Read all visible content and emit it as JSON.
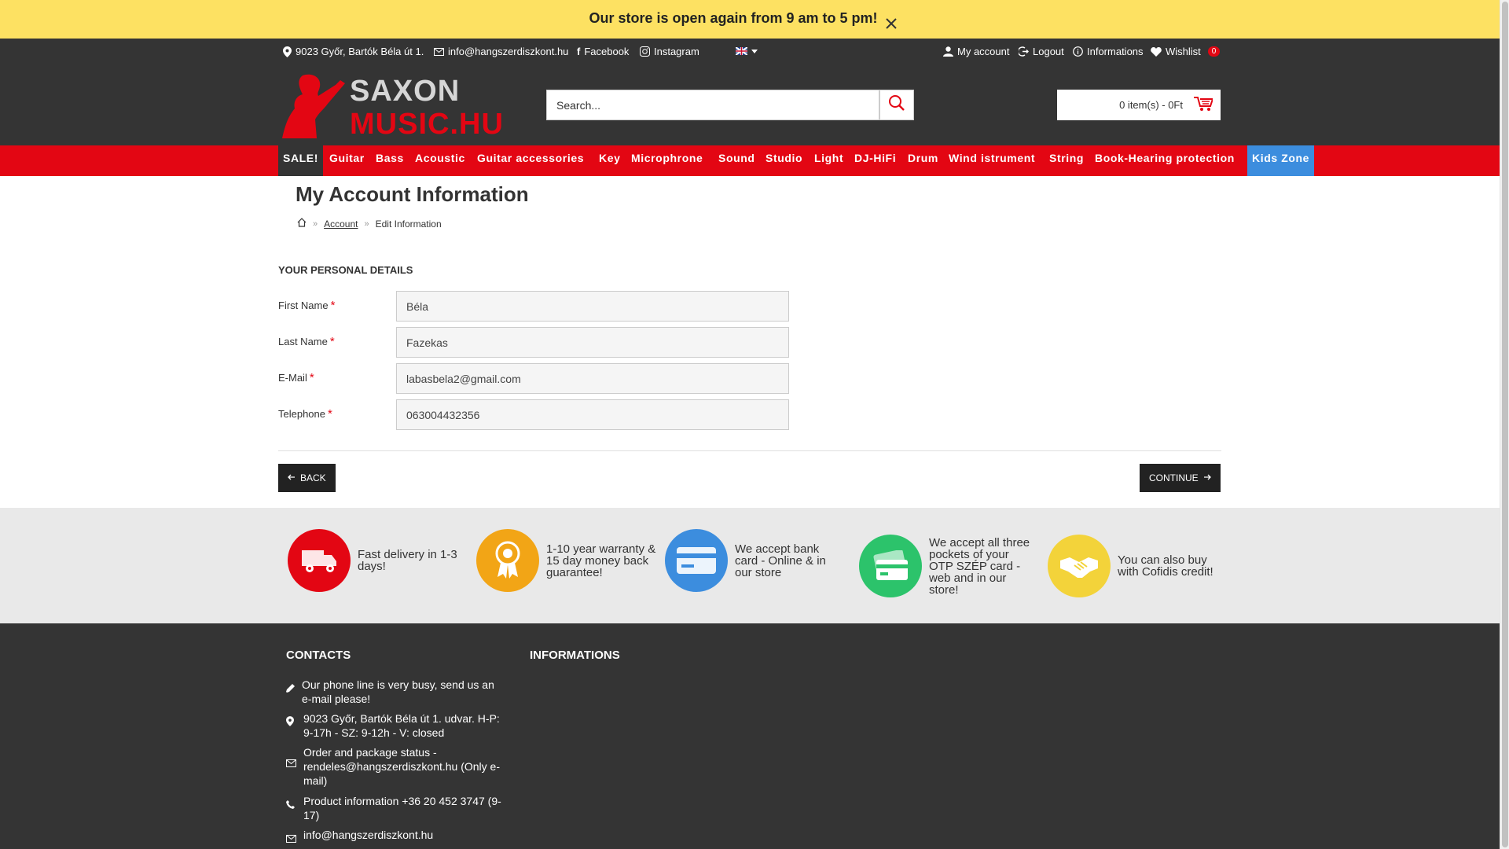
{
  "notice": {
    "text": "Our store is open again from 9 am to 5 pm!",
    "close_icon": "close-icon"
  },
  "topbar": {
    "address": "9023 Győr, Bartók Béla út 1.",
    "email": "info@hangszerdiszkont.hu",
    "facebook": "Facebook",
    "instagram": "Instagram",
    "language_icon": "uk-flag-icon",
    "my_account": "My account",
    "logout": "Logout",
    "informations": "Informations",
    "wishlist": "Wishlist",
    "wishlist_count": "0"
  },
  "header": {
    "logo_line1": "SAXON",
    "logo_line2": "MUSIC.HU",
    "search_placeholder": "Search...",
    "cart_text": "0 item(s) - 0Ft"
  },
  "menu": {
    "items": [
      "SALE!",
      "Guitar",
      "Bass",
      "Acoustic",
      "Guitar accessories",
      "Key",
      "Microphrone",
      "Sound",
      "Studio",
      "Light",
      "DJ-HiFi",
      "Drum",
      "Wind istrument",
      "String",
      "Book-Hearing protection",
      "Kids Zone"
    ]
  },
  "page": {
    "title": "My Account Information",
    "breadcrumb": [
      "Account",
      "Edit Information"
    ]
  },
  "form": {
    "legend": "YOUR PERSONAL DETAILS",
    "fields": [
      {
        "label": "First Name",
        "value": "Béla"
      },
      {
        "label": "Last Name",
        "value": "Fazekas"
      },
      {
        "label": "E-Mail",
        "value": "labasbela2@gmail.com"
      },
      {
        "label": "Telephone",
        "value": "063004432356"
      }
    ],
    "required_mark": "*",
    "back_label": "BACK",
    "continue_label": "CONTINUE"
  },
  "features": [
    {
      "text": "Fast delivery in 1-3 days!",
      "icon": "truck-icon",
      "color": "#e30613"
    },
    {
      "text": "1-10 year warranty & 15 day money back guarantee!",
      "icon": "award-icon",
      "color": "#f2a516"
    },
    {
      "text": "We accept bank card - Online & in our store",
      "icon": "credit-card-icon",
      "color": "#3c8dde"
    },
    {
      "text": "We accept all three pockets of your OTP SZÉP card - web and in our store!",
      "icon": "payment-card-icon",
      "color": "#2cc36b"
    },
    {
      "text": "You can also buy with Cofidis credit!",
      "icon": "handshake-icon",
      "color": "#f3d33a"
    }
  ],
  "footer": {
    "contacts_title": "CONTACTS",
    "informations_title": "INFORMATIONS",
    "contacts": [
      {
        "text": "Our phone line is very busy, send us an e-mail please!",
        "icon": "pen-icon"
      },
      {
        "text": "9023 Győr, Bartók Béla út 1. udvar. H-P: 9-17h - SZ: 9-12h - V: closed",
        "icon": "location-icon"
      },
      {
        "text": "Order and package status - rendeles@hangszerdiszkont.hu (Only e-mail)",
        "icon": "mail-icon"
      },
      {
        "text": "Product information +36 20 452 3747 (9-17)",
        "icon": "phone-icon"
      },
      {
        "text": "info@hangszerdiszkont.hu",
        "icon": "mail-icon"
      }
    ]
  },
  "colors": {
    "brand_red": "#e30613",
    "dark": "#343434",
    "notice_yellow": "#fde162",
    "kids_blue": "#3c8dde"
  }
}
